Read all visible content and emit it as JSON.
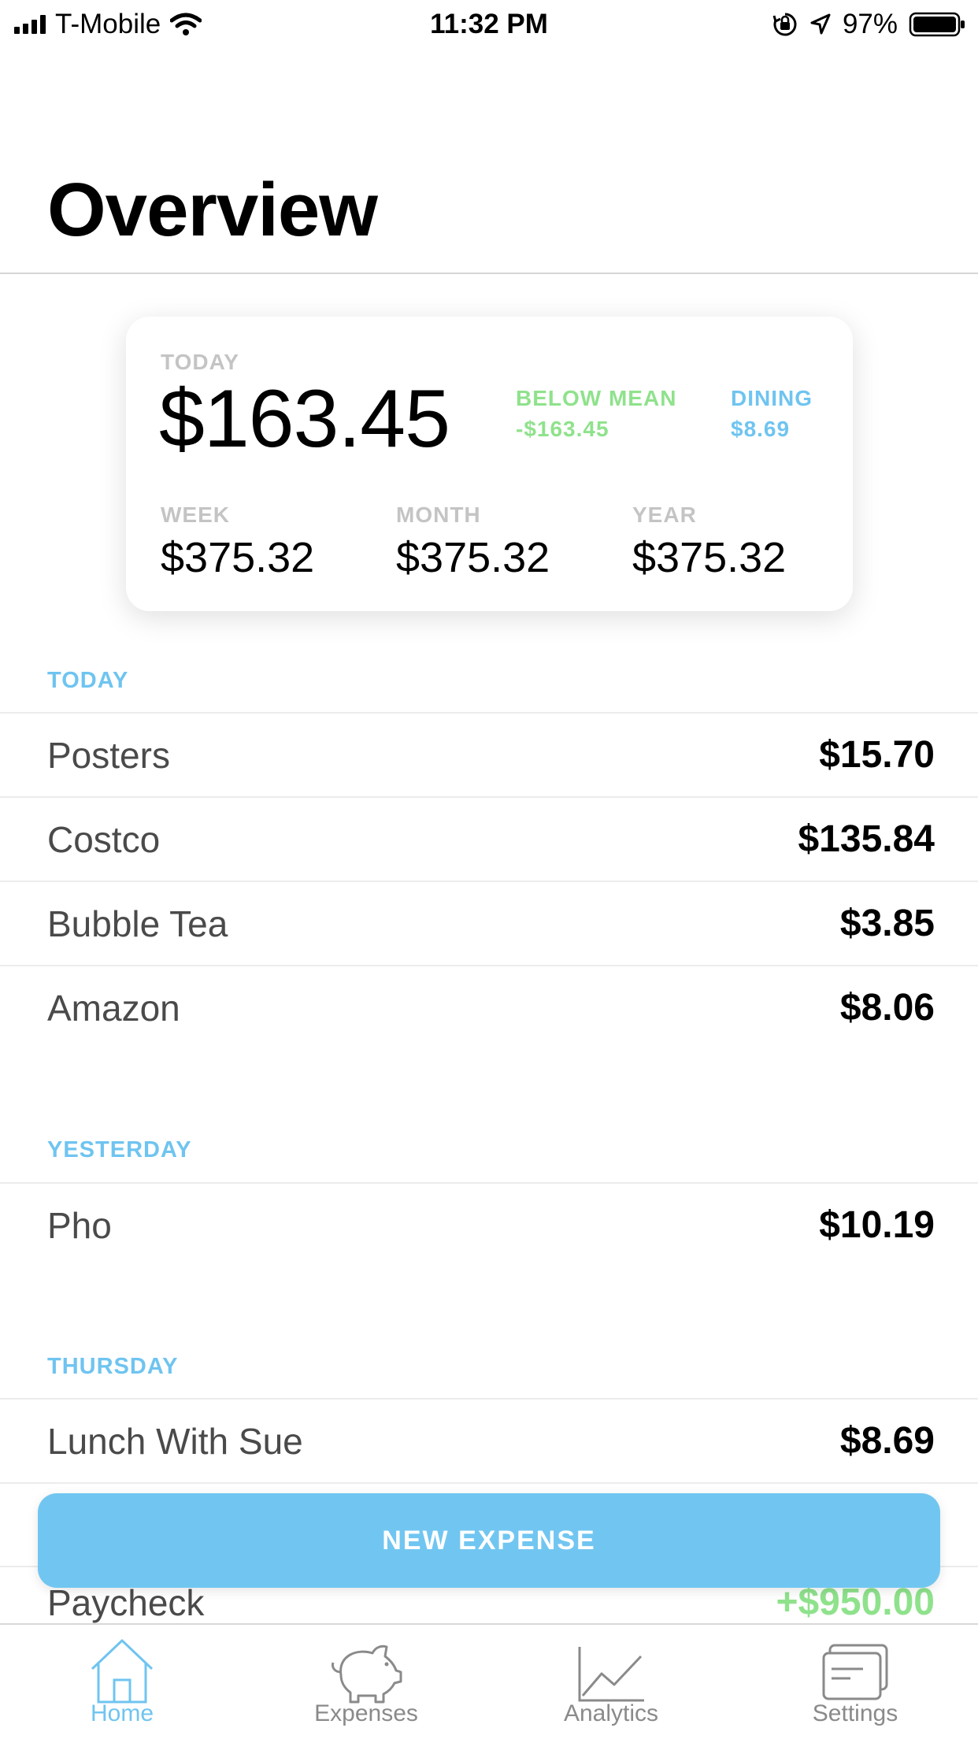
{
  "status_bar": {
    "carrier": "T-Mobile",
    "time": "11:32 PM",
    "battery": "97%"
  },
  "page": {
    "title": "Overview"
  },
  "summary": {
    "today_label": "TODAY",
    "today_value": "$163.45",
    "below_mean_label": "BELOW MEAN",
    "below_mean_value": "-$163.45",
    "dining_label": "DINING",
    "dining_value": "$8.69",
    "week_label": "WEEK",
    "week_value": "$375.32",
    "month_label": "MONTH",
    "month_value": "$375.32",
    "year_label": "YEAR",
    "year_value": "$375.32"
  },
  "sections": [
    {
      "header": "TODAY",
      "items": [
        {
          "name": "Posters",
          "amount": "$15.70"
        },
        {
          "name": "Costco",
          "amount": "$135.84"
        },
        {
          "name": "Bubble Tea",
          "amount": "$3.85"
        },
        {
          "name": "Amazon",
          "amount": "$8.06"
        }
      ]
    },
    {
      "header": "YESTERDAY",
      "items": [
        {
          "name": "Pho",
          "amount": "$10.19"
        }
      ]
    },
    {
      "header": "THURSDAY",
      "items": [
        {
          "name": "Lunch With Sue",
          "amount": "$8.69"
        },
        {
          "name": "Paycheck",
          "amount": "+$950.00"
        }
      ]
    }
  ],
  "new_expense_label": "NEW EXPENSE",
  "tabs": [
    {
      "label": "Home",
      "icon": "home-icon",
      "active": true
    },
    {
      "label": "Expenses",
      "icon": "piggy-bank-icon",
      "active": false
    },
    {
      "label": "Analytics",
      "icon": "line-chart-icon",
      "active": false
    },
    {
      "label": "Settings",
      "icon": "settings-cards-icon",
      "active": false
    }
  ],
  "colors": {
    "accent_blue": "#6fc4f0",
    "positive_green": "#8fe28c",
    "button_blue": "#71c6f1"
  }
}
